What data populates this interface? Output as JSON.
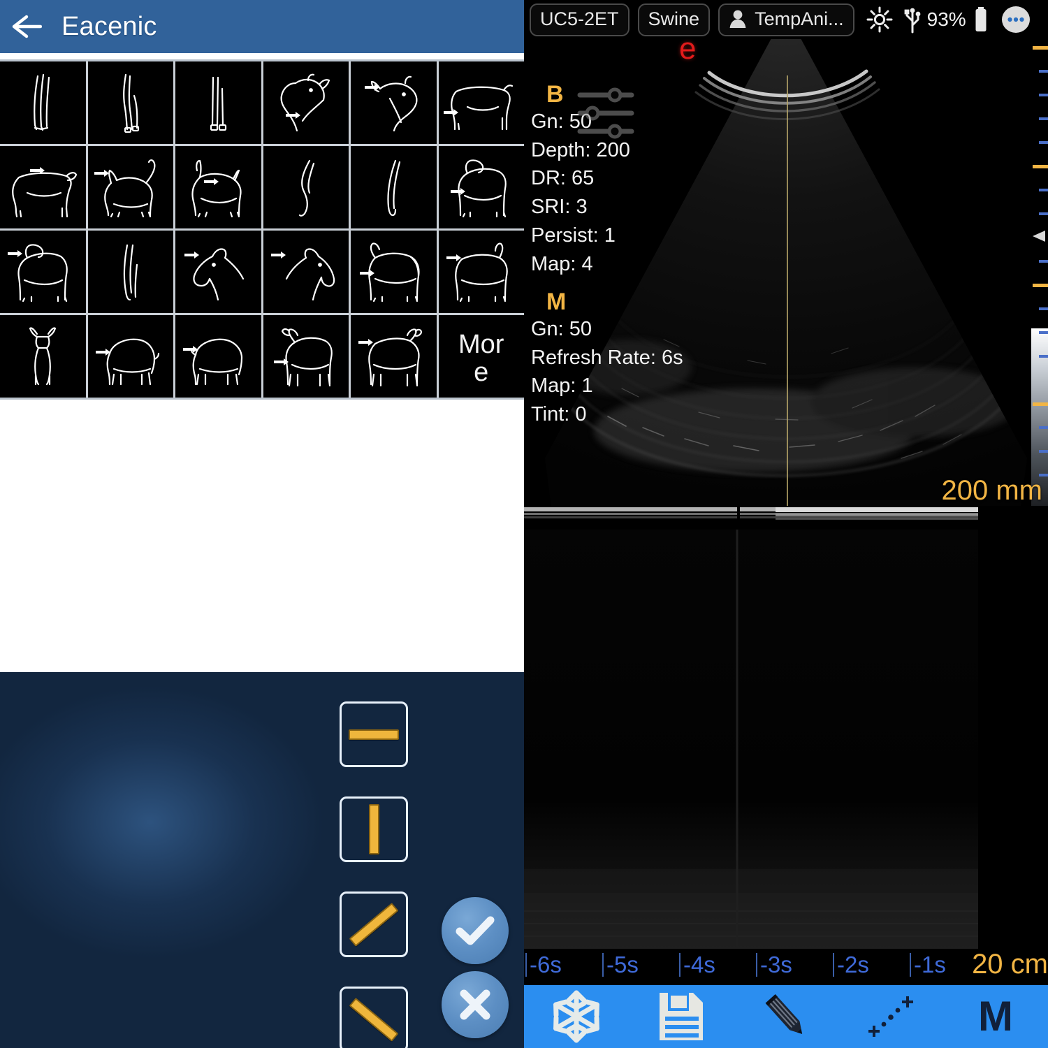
{
  "left_app": {
    "header": {
      "back_icon": "back-arrow-icon",
      "title": "Eacenic"
    },
    "grid": {
      "columns": 6,
      "rows": 4,
      "cells": [
        {
          "icon": "cow-legs-front-icon",
          "label": ""
        },
        {
          "icon": "cow-legs-rear-icon",
          "label": ""
        },
        {
          "icon": "cow-legs-straight-icon",
          "label": ""
        },
        {
          "icon": "cow-head-icon",
          "label": ""
        },
        {
          "icon": "cow-head-arrow-icon",
          "label": ""
        },
        {
          "icon": "cow-body-icon",
          "label": ""
        },
        {
          "icon": "cow-side-icon",
          "label": ""
        },
        {
          "icon": "cat-standing-icon",
          "label": ""
        },
        {
          "icon": "cat-walking-icon",
          "label": ""
        },
        {
          "icon": "dog-leg-hind-icon",
          "label": ""
        },
        {
          "icon": "dog-leg-fore-icon",
          "label": ""
        },
        {
          "icon": "dog-standing-icon",
          "label": ""
        },
        {
          "icon": "dog-side-icon",
          "label": ""
        },
        {
          "icon": "horse-legs-icon",
          "label": ""
        },
        {
          "icon": "horse-head-left-icon",
          "label": ""
        },
        {
          "icon": "horse-head-right-icon",
          "label": ""
        },
        {
          "icon": "horse-body-icon",
          "label": ""
        },
        {
          "icon": "horse-side-icon",
          "label": ""
        },
        {
          "icon": "goat-front-icon",
          "label": ""
        },
        {
          "icon": "pig-left-icon",
          "label": ""
        },
        {
          "icon": "pig-right-icon",
          "label": ""
        },
        {
          "icon": "sheep-left-icon",
          "label": ""
        },
        {
          "icon": "sheep-right-icon",
          "label": ""
        },
        {
          "icon": "more-cell",
          "label": "Mor",
          "label2": "e"
        }
      ]
    },
    "line_tools": {
      "buttons": [
        {
          "name": "line-horizontal",
          "icon": "line-horizontal-icon"
        },
        {
          "name": "line-vertical",
          "icon": "line-vertical-icon"
        },
        {
          "name": "line-diagonal-up",
          "icon": "line-diagonal-up-icon"
        },
        {
          "name": "line-diagonal-down",
          "icon": "line-diagonal-down-icon"
        }
      ],
      "confirm_icon": "check-icon",
      "cancel_icon": "close-icon"
    }
  },
  "ultrasound": {
    "topbar": {
      "probe": "UC5-2ET",
      "preset": "Swine",
      "patient": "TempAni...",
      "patient_icon": "person-icon",
      "brightness_icon": "brightness-icon",
      "usb_icon": "usb-icon",
      "battery_percent": "93%",
      "battery_icon": "battery-icon",
      "more_icon": "more-options-icon"
    },
    "orientation_marker": "e",
    "params": {
      "b_mode": {
        "mode": "B",
        "sliders_icon": "sliders-icon",
        "lines": [
          "Gn: 50",
          "Depth: 200",
          "DR: 65",
          "SRI: 3",
          "Persist: 1",
          "Map: 4"
        ]
      },
      "m_mode": {
        "mode": "M",
        "lines": [
          "Gn: 50",
          "Refresh Rate: 6s",
          "Map: 1",
          "Tint: 0"
        ]
      }
    },
    "depth_label": "200 mm",
    "scale_label": "20 cm",
    "time_axis": {
      "labels": [
        "-6s",
        "-5s",
        "-4s",
        "-3s",
        "-2s",
        "-1s"
      ]
    },
    "toolbar": {
      "items": [
        {
          "name": "freeze-button",
          "icon": "snowflake-icon"
        },
        {
          "name": "save-button",
          "icon": "floppy-disk-icon"
        },
        {
          "name": "annotate-button",
          "icon": "pencil-icon"
        },
        {
          "name": "measure-button",
          "icon": "caliper-icon"
        },
        {
          "name": "mode-m-button",
          "icon": "m-mode-icon",
          "label": "M"
        }
      ]
    }
  },
  "colors": {
    "header_blue": "#31629a",
    "toolbar_blue": "#2b8ef0",
    "panel_navy": "#12263f",
    "accent_yellow": "#f2b544",
    "tool_yellow": "#efb63c",
    "marker_red": "#e31b1b",
    "time_blue": "#3f6ad8"
  }
}
